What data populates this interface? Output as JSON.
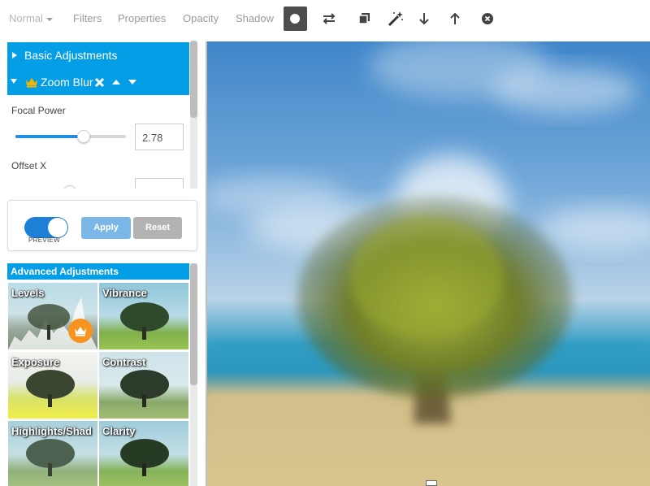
{
  "toolbar": {
    "blend_mode": "Normal",
    "filters": "Filters",
    "properties": "Properties",
    "opacity": "Opacity",
    "shadow": "Shadow"
  },
  "panel": {
    "basic_adjustments": "Basic Adjustments",
    "zoom_blur": "Zoom Blur",
    "focal_power_label": "Focal Power",
    "focal_power_value": "2.78",
    "focal_power_level": 0.62,
    "offset_x_label": "Offset X",
    "preview_label": "PREVIEW",
    "preview_on": true,
    "apply": "Apply",
    "reset": "Reset",
    "advanced_adjustments": "Advanced Adjustments",
    "thumbs": [
      "Levels",
      "Vibrance",
      "Exposure",
      "Contrast",
      "Highlights/Shad",
      "Clarity"
    ]
  },
  "colors": {
    "accent": "#049ee6",
    "toggle": "#1e7fd6",
    "apply_button": "#7ab7e6",
    "reset_button": "#b3b3b3",
    "premium_badge": "#f7941d"
  },
  "icons": [
    "circle-tool-icon",
    "swap-icon",
    "duplicate-icon",
    "magic-wand-icon",
    "arrow-down-icon",
    "arrow-up-icon",
    "close-circle-icon",
    "caret-right-icon",
    "caret-down-icon",
    "crown-icon",
    "remove-icon",
    "move-up-icon",
    "move-down-icon"
  ]
}
